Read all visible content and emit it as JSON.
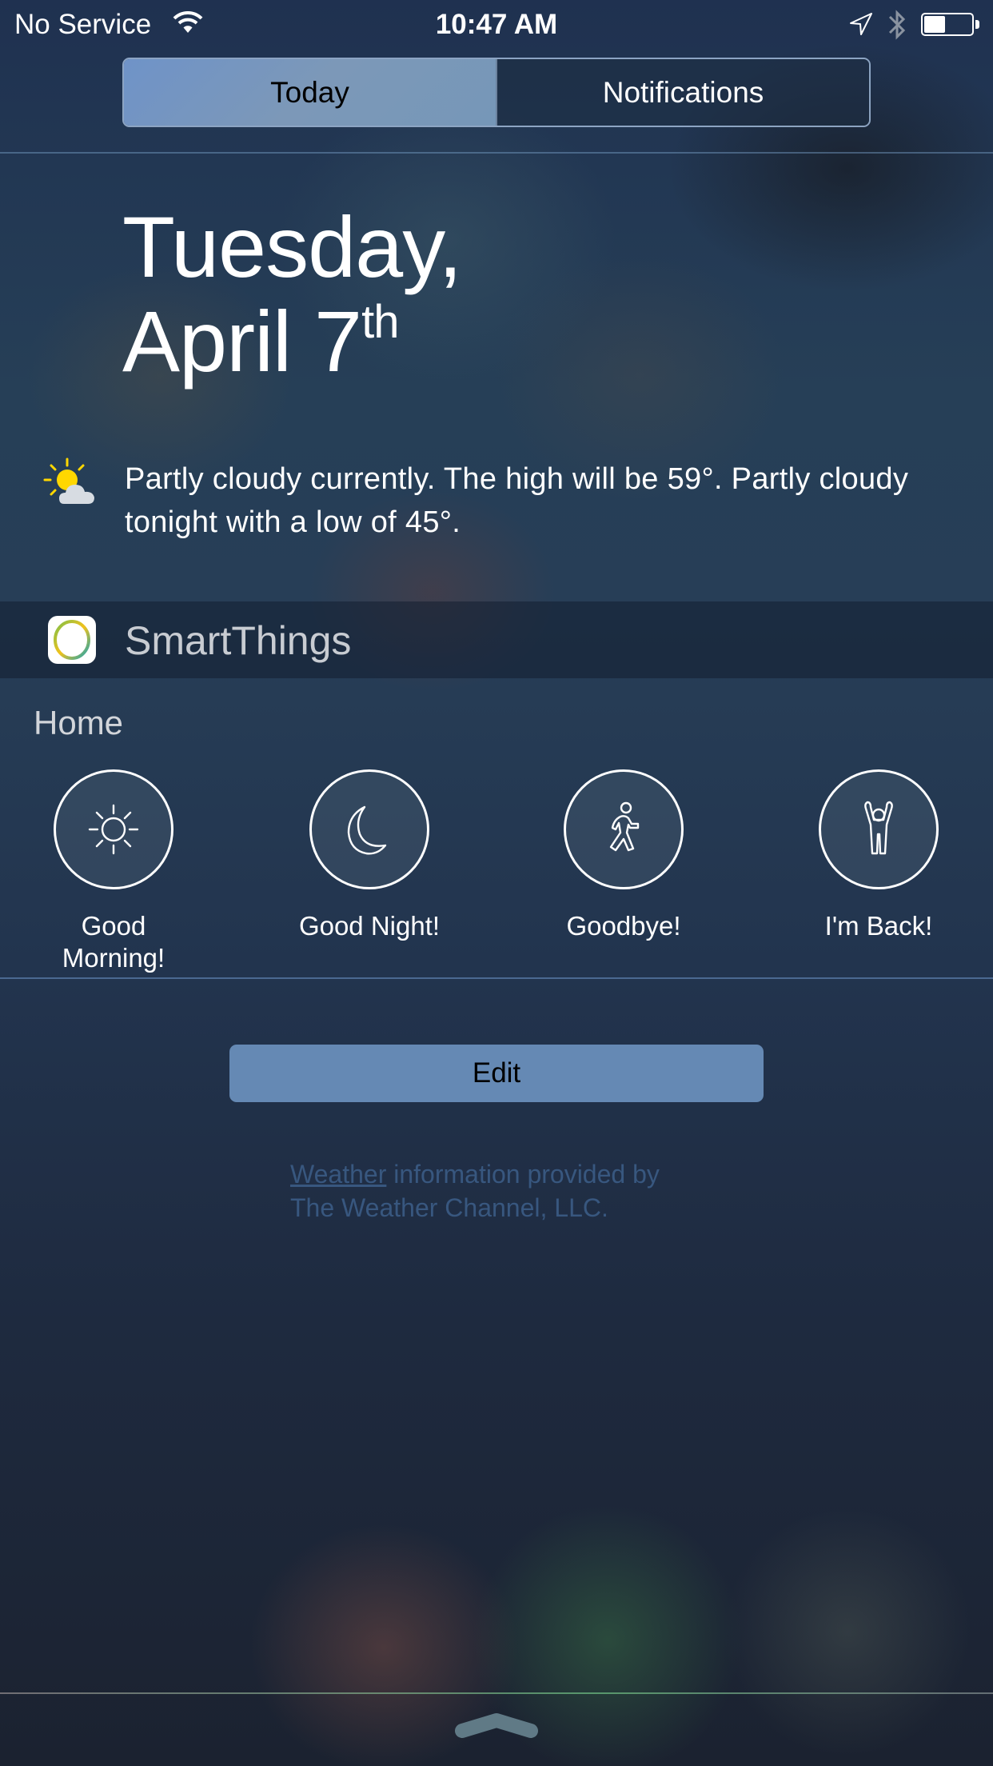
{
  "status_bar": {
    "carrier": "No Service",
    "time": "10:47 AM",
    "battery_level": 0.45,
    "icons": [
      "wifi-icon",
      "location-arrow-icon",
      "bluetooth-icon",
      "battery-icon"
    ]
  },
  "segmented_control": {
    "tabs": [
      {
        "label": "Today",
        "selected": true
      },
      {
        "label": "Notifications",
        "selected": false
      }
    ]
  },
  "date": {
    "weekday": "Tuesday,",
    "month_day": "April 7",
    "ordinal_suffix": "th"
  },
  "weather": {
    "icon": "partly-cloudy-icon",
    "summary": "Partly cloudy currently. The high will be 59°. Partly cloudy tonight with a low of 45°."
  },
  "widget": {
    "app_name": "SmartThings",
    "app_icon": "smartthings-logo-icon",
    "location_label": "Home",
    "routines": [
      {
        "label": "Good Morning!",
        "icon": "sun-icon"
      },
      {
        "label": "Good Night!",
        "icon": "moon-icon"
      },
      {
        "label": "Goodbye!",
        "icon": "walking-person-icon"
      },
      {
        "label": "I'm Back!",
        "icon": "person-arms-raised-icon"
      }
    ]
  },
  "edit_button": {
    "label": "Edit"
  },
  "attribution": {
    "link_text": "Weather",
    "text_line1": " information provided by",
    "text_line2": "The Weather Channel, LLC."
  },
  "colors": {
    "accent_segment": "#7697b8",
    "edit_button": "#6589b4",
    "attribution_text": "#38577f"
  }
}
